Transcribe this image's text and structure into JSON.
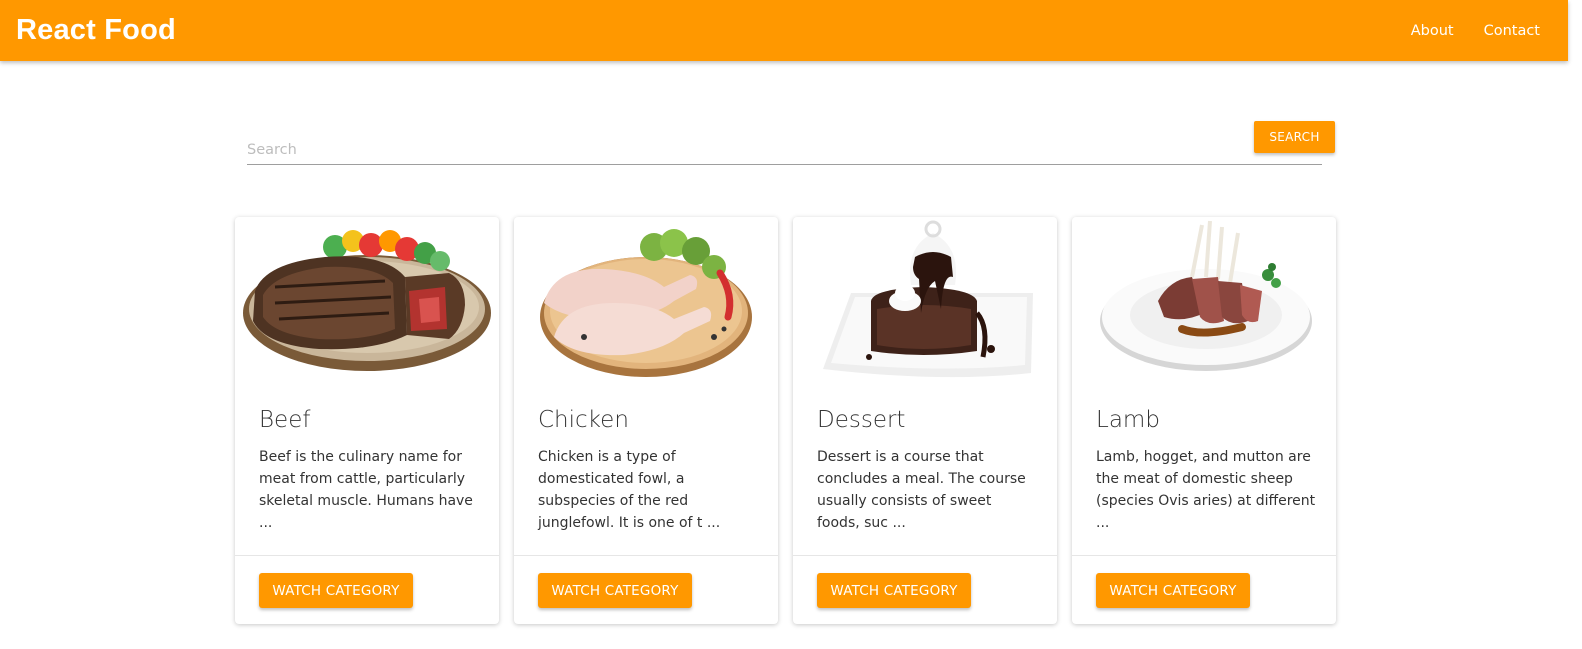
{
  "app": {
    "title": "React Food"
  },
  "nav": {
    "about": "About",
    "contact": "Contact"
  },
  "search": {
    "placeholder": "Search",
    "value": "",
    "button_label": "SEARCH"
  },
  "categories": [
    {
      "title": "Beef",
      "description": "Beef is the culinary name for meat from cattle, particularly skeletal muscle. Humans have ...",
      "button": "WATCH CATEGORY",
      "image": "beef-steak-plate"
    },
    {
      "title": "Chicken",
      "description": "Chicken is a type of domesticated fowl, a subspecies of the red junglefowl. It is one of t ...",
      "button": "WATCH CATEGORY",
      "image": "raw-chicken-board"
    },
    {
      "title": "Dessert",
      "description": "Dessert is a course that concludes a meal. The course usually consists of sweet foods, suc ...",
      "button": "WATCH CATEGORY",
      "image": "chocolate-cake-plate"
    },
    {
      "title": "Lamb",
      "description": "Lamb, hogget, and mutton are the meat of domestic sheep (species Ovis aries) at different ...",
      "button": "WATCH CATEGORY",
      "image": "lamb-rack-plate"
    }
  ],
  "colors": {
    "accent": "#ff9800",
    "text": "#333333",
    "background": "#ffffff"
  }
}
